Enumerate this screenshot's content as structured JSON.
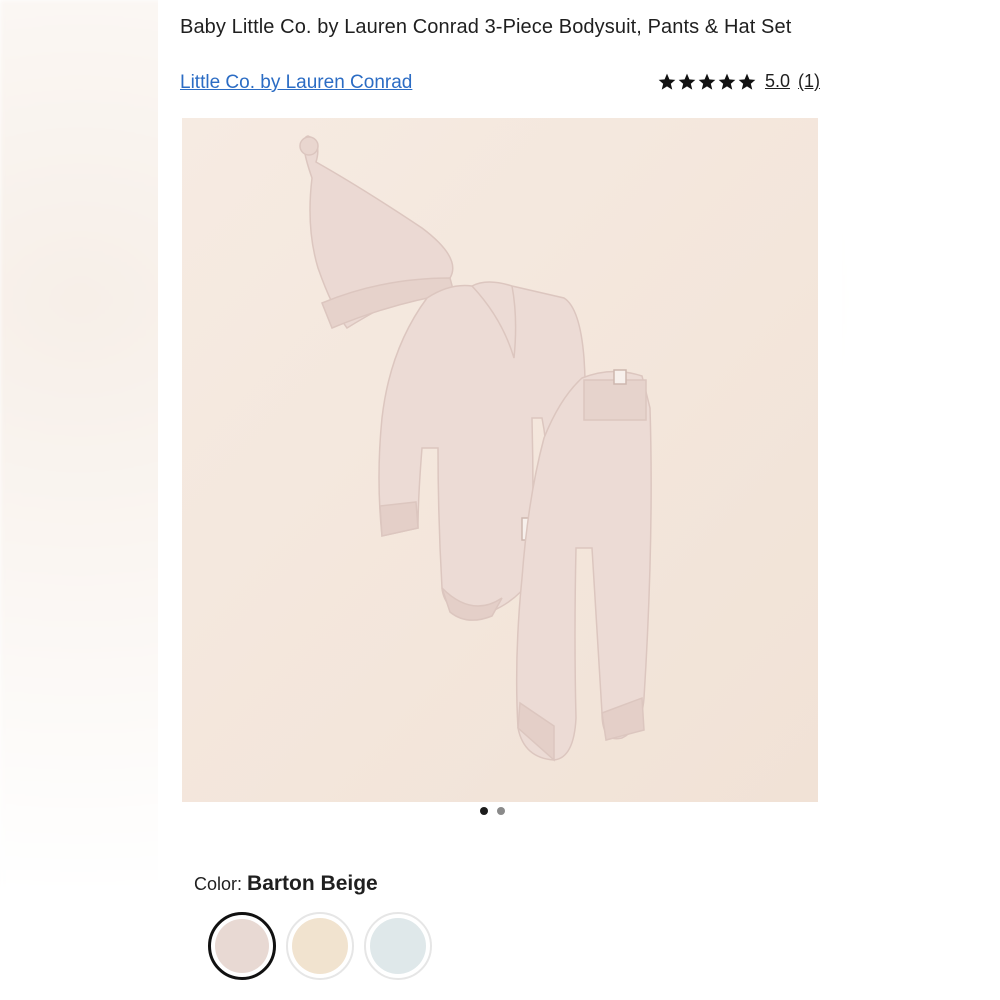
{
  "product": {
    "title": "Baby Little Co. by Lauren Conrad 3-Piece Bodysuit, Pants & Hat Set",
    "brand": "Little Co. by Lauren Conrad",
    "rating_value": "5.0",
    "rating_count": "(1)",
    "rating_stars": 5
  },
  "image": {
    "dots_count": 2,
    "active_dot": 1
  },
  "color": {
    "label": "Color:",
    "selected": "Barton Beige",
    "swatches": [
      {
        "name": "pink-beige",
        "hex": "#e8d9d3"
      },
      {
        "name": "cream",
        "hex": "#f1e3cf"
      },
      {
        "name": "light-blue",
        "hex": "#dfe8ea"
      }
    ]
  },
  "colors": {
    "link": "#2b6cc4",
    "image_bg": "#f4e7dc",
    "garment": "#ead8d2"
  }
}
